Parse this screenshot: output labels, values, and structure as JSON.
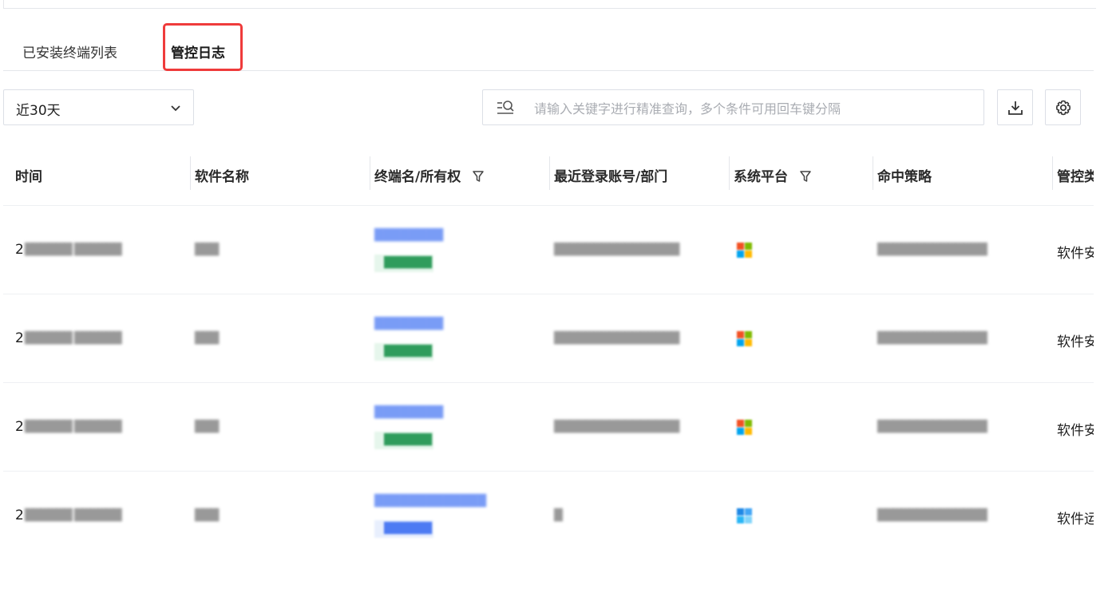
{
  "tabs": [
    {
      "label": "已安装终端列表",
      "active": false
    },
    {
      "label": "管控日志",
      "active": true
    }
  ],
  "filter": {
    "range_value": "近30天",
    "search_placeholder": "请输入关键字进行精准查询，多个条件可用回车键分隔"
  },
  "toolbar_icons": [
    "download-icon",
    "gear-icon"
  ],
  "table": {
    "columns": [
      "时间",
      "软件名称",
      "终端名/所有权",
      "最近登录账号/部门",
      "系统平台",
      "命中策略",
      "管控类"
    ],
    "rows": [
      {
        "time_first_char": "2",
        "control_type": "软件安",
        "platform": "windows"
      },
      {
        "time_first_char": "2",
        "control_type": "软件安",
        "platform": "windows"
      },
      {
        "time_first_char": "2",
        "control_type": "软件安",
        "platform": "windows"
      },
      {
        "time_first_char": "2",
        "control_type": "软件运",
        "platform": "windows-blue"
      }
    ]
  },
  "colors": {
    "highlight": "#ef3b3b",
    "link": "#4d7bf3",
    "tag_green": "#2f9c5c"
  }
}
